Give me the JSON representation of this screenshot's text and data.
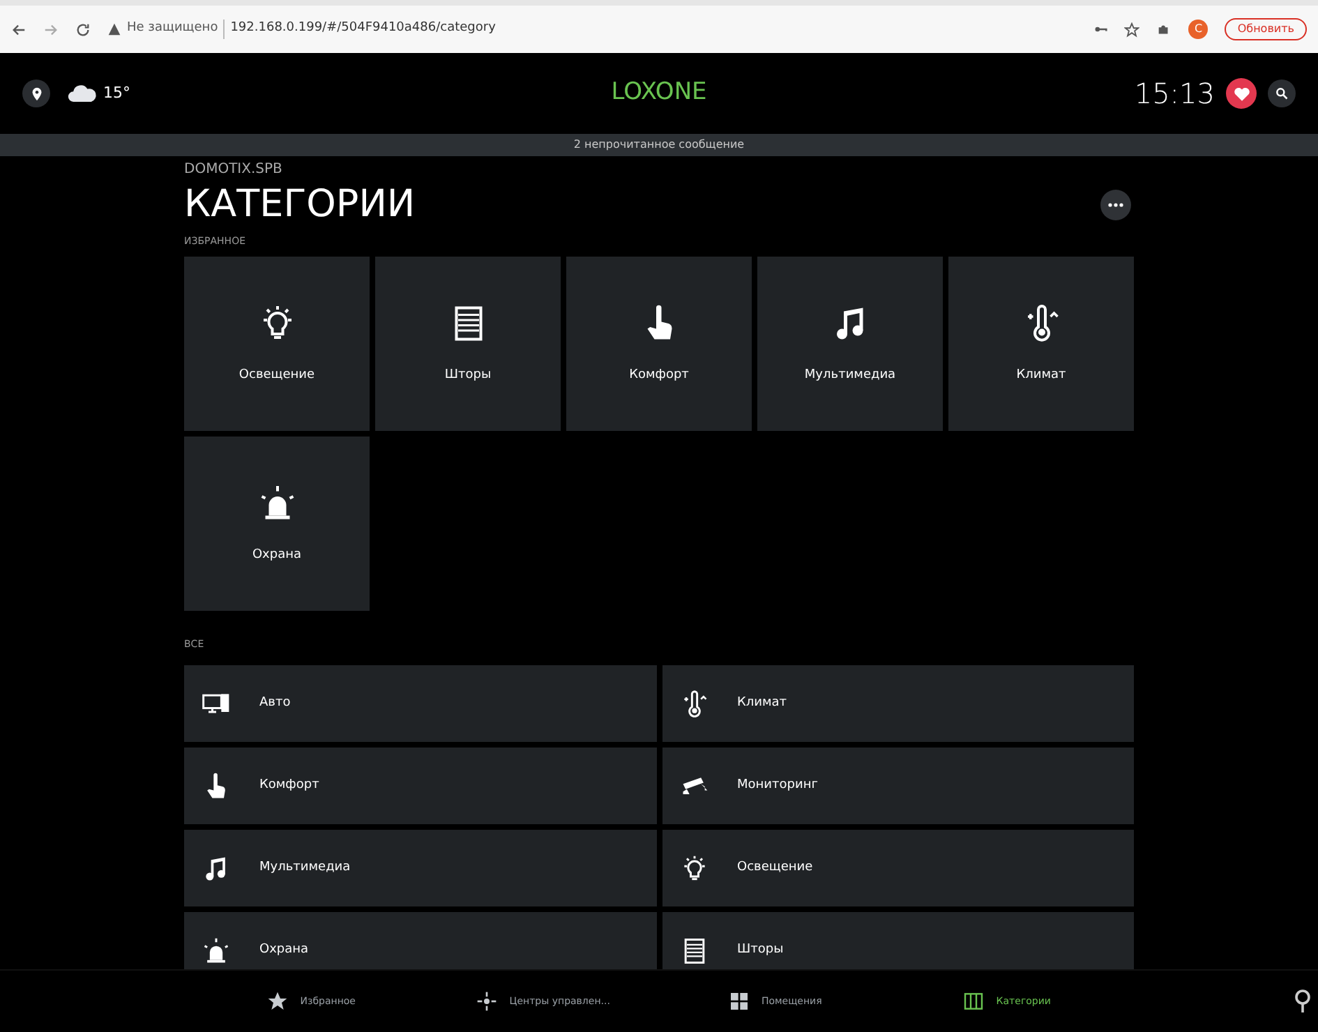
{
  "browser": {
    "security": "Не защищено",
    "url": "192.168.0.199/#/504F9410a486/category",
    "avatar": "С",
    "update_button": "Обновить"
  },
  "header": {
    "temperature": "15°",
    "logo": "LOXONE",
    "time": "15:13"
  },
  "message_bar": "2 непрочитанное сообщение",
  "page": {
    "subtitle": "DOMOTIX.SPB",
    "title": "КАТЕГОРИИ"
  },
  "favorites": {
    "heading": "ИЗБРАННОЕ",
    "tiles": [
      {
        "label": "Освещение",
        "kind": "bulb"
      },
      {
        "label": "Шторы",
        "kind": "blinds"
      },
      {
        "label": "Комфорт",
        "kind": "hand"
      },
      {
        "label": "Мультимедиа",
        "kind": "music"
      },
      {
        "label": "Климат",
        "kind": "thermo"
      },
      {
        "label": "Охрана",
        "kind": "alarm"
      }
    ]
  },
  "all": {
    "heading": "ВСЕ",
    "items": [
      {
        "label": "Авто",
        "kind": "computer"
      },
      {
        "label": "Климат",
        "kind": "thermo"
      },
      {
        "label": "Комфорт",
        "kind": "hand"
      },
      {
        "label": "Мониторинг",
        "kind": "camera"
      },
      {
        "label": "Мультимедиа",
        "kind": "music"
      },
      {
        "label": "Освещение",
        "kind": "bulb"
      },
      {
        "label": "Охрана",
        "kind": "alarm"
      },
      {
        "label": "Шторы",
        "kind": "blinds"
      }
    ]
  },
  "bottom_nav": [
    {
      "label": "Избранное",
      "kind": "star",
      "selected": false
    },
    {
      "label": "Центры управлен...",
      "kind": "hub",
      "selected": false
    },
    {
      "label": "Помещения",
      "kind": "rooms",
      "selected": false
    },
    {
      "label": "Категории",
      "kind": "categories",
      "selected": true
    }
  ]
}
